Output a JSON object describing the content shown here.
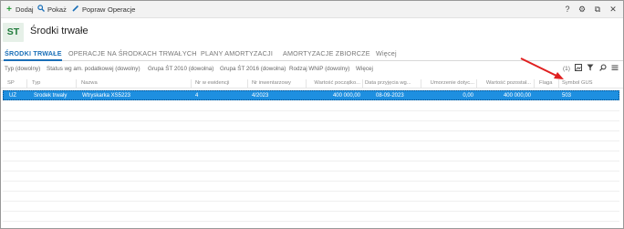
{
  "toolbar": {
    "add_label": "Dodaj",
    "show_label": "Pokaż",
    "edit_label": "Popraw",
    "operations_label": "Operacje",
    "right_icons": [
      "?",
      "⚙",
      "⧉",
      "✕"
    ]
  },
  "header": {
    "badge": "ST",
    "title": "Środki trwałe"
  },
  "tabs": [
    {
      "label": "ŚRODKI TRWAŁE",
      "active": true
    },
    {
      "label": "OPERACJE NA ŚRODKACH TRWAŁYCH",
      "active": false
    },
    {
      "label": "PLANY AMORTYZACJI",
      "active": false
    },
    {
      "label": "AMORTYZACJE ZBIORCZE",
      "active": false
    },
    {
      "label": "Więcej",
      "active": false
    }
  ],
  "filters": [
    "Typ (dowolny)",
    "Status wg am. podatkowej (dowolny)",
    "Grupa ŚT 2010 (dowolna)",
    "Grupa ŚT 2016 (dowolna)",
    "Rodzaj WNiP (dowolny)",
    "Więcej"
  ],
  "filter_right": {
    "count": "(1)"
  },
  "columns": [
    "SP",
    "Typ",
    "Nazwa",
    "Nr w ewidencji",
    "Nr inwentarzowy",
    "Wartość początko...",
    "Data przyjęcia wg...",
    "Umorzenie dotyc...",
    "Wartość pozostał...",
    "Flaga",
    "Symbol GUS"
  ],
  "rows": [
    {
      "sp": "UŻ",
      "typ": "Środek trwały",
      "nazwa": "Wtryskarka XS5223",
      "nr_ewid": "4",
      "nr_inw": "4/2023",
      "wartosc_pocz": "400 000,00",
      "data_przyj": "08-09-2023",
      "umorzenie": "0,00",
      "wartosc_poz": "400 000,00",
      "flaga": "",
      "symbol_gus": "503"
    }
  ],
  "colors": {
    "accent": "#1a6fb8",
    "selection": "#1e8fe0",
    "annotation_arrow": "#e02020",
    "badge_text": "#1f7a3a"
  }
}
